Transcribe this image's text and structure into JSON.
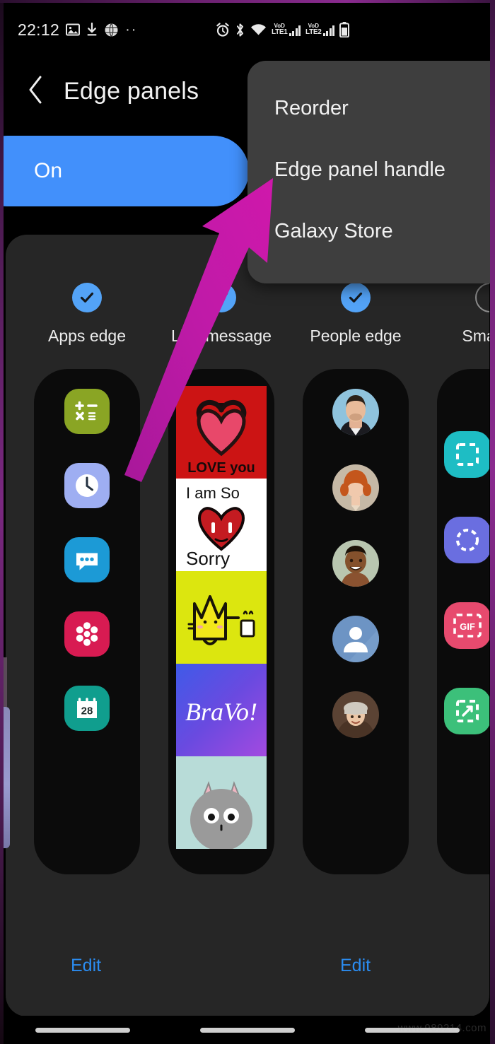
{
  "status_bar": {
    "time": "22:12",
    "left_icons": [
      "image-icon",
      "download-icon",
      "globe-icon",
      "more-dots-icon"
    ],
    "right_icons": [
      "alarm-icon",
      "bluetooth-icon",
      "wifi-icon",
      "volte1-signal-icon",
      "volte2-signal-icon",
      "battery-icon"
    ],
    "volte1_top": "VoD",
    "volte1_bottom": "LTE1",
    "volte2_top": "VoD",
    "volte2_bottom": "LTE2"
  },
  "app_bar": {
    "back_icon": "chevron-left-icon",
    "title": "Edge panels"
  },
  "toggle": {
    "label": "On",
    "state": "on",
    "color": "#4290fb"
  },
  "overflow_menu": {
    "items": [
      {
        "label": "Reorder"
      },
      {
        "label": "Edge panel handle"
      },
      {
        "label": "Galaxy Store"
      }
    ]
  },
  "panels": [
    {
      "label": "Apps edge",
      "checked": true,
      "type": "apps",
      "icons": [
        {
          "name": "calculator-icon",
          "color": "#8aa524"
        },
        {
          "name": "clock-icon",
          "color": "#9eaef2"
        },
        {
          "name": "messages-icon",
          "color": "#1c9ad6"
        },
        {
          "name": "gallery-flower-icon",
          "color": "#d81b52"
        },
        {
          "name": "calendar-icon",
          "color": "#109e8e",
          "day": "28"
        }
      ]
    },
    {
      "label": "Live message",
      "checked": true,
      "type": "live",
      "stickers": [
        {
          "name": "love-you-sticker",
          "text": "LOVE you",
          "bg": "#cc1414"
        },
        {
          "name": "i-am-so-sorry-sticker",
          "text": "I am So Sorry",
          "bg": "#ffffff"
        },
        {
          "name": "yellow-cat-sticker",
          "text": "",
          "bg": "#dce60f"
        },
        {
          "name": "bravo-sticker",
          "text": "BraVo!",
          "bg": "#4a5ae8"
        },
        {
          "name": "grey-cat-sticker",
          "text": "",
          "bg": "#b8dcd8"
        }
      ]
    },
    {
      "label": "People edge",
      "checked": true,
      "type": "people",
      "contacts": [
        {
          "name": "contact-avatar-1",
          "bg": "#8fc3dd",
          "skin": "#e3b294",
          "hair": "#2b2119"
        },
        {
          "name": "contact-avatar-2",
          "bg": "#c6b9a6",
          "skin": "#f0c9ad",
          "hair": "#c4561c"
        },
        {
          "name": "contact-avatar-3",
          "bg": "#b9c6b0",
          "skin": "#84512c",
          "hair": "#1c1208"
        },
        {
          "name": "contact-avatar-default",
          "bg": "#6d94c4",
          "skin": "#ffffff",
          "hair": "#ffffff"
        },
        {
          "name": "contact-avatar-5",
          "bg": "#5b4334",
          "skin": "#ecc7a7",
          "hair": "#cfcac0"
        }
      ]
    },
    {
      "label": "Smart s",
      "checked": false,
      "type": "smart",
      "icons": [
        {
          "name": "rectangle-select-icon",
          "color": "#1ebdc4"
        },
        {
          "name": "oval-select-icon",
          "color": "#6a6ee0"
        },
        {
          "name": "gif-capture-icon",
          "color": "#e74a6e",
          "text": "GIF"
        },
        {
          "name": "pin-to-screen-icon",
          "color": "#3cc07a"
        }
      ]
    }
  ],
  "edit_links": [
    {
      "label": "Edit"
    },
    {
      "label": "Edit"
    }
  ],
  "annotation": {
    "type": "arrow",
    "color": "#bd19a3",
    "points_at": "Edge panel handle"
  },
  "nav_bar": {
    "buttons": [
      "recents-pill",
      "home-pill",
      "back-pill"
    ]
  },
  "watermark": {
    "text": "www.989214.com"
  }
}
